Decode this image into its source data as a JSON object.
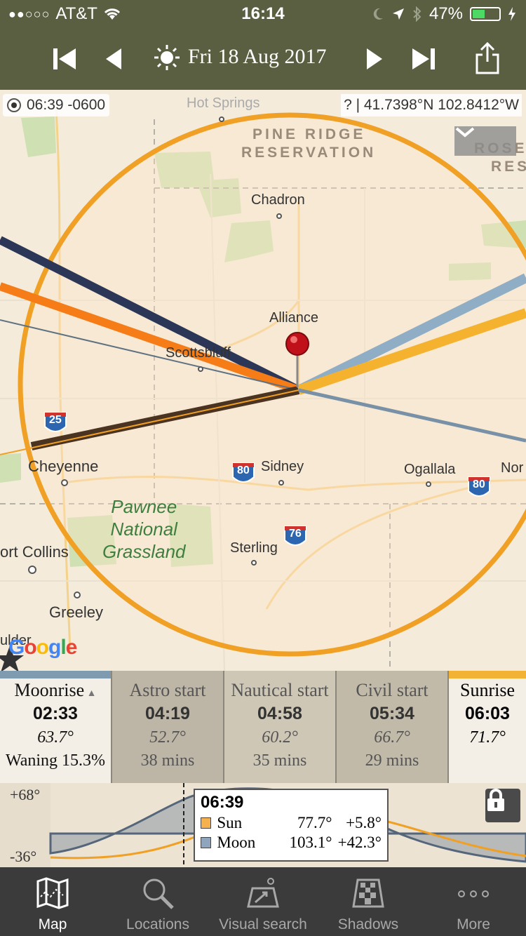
{
  "status_bar": {
    "carrier": "AT&T",
    "signal_dots": "●●○○○",
    "time": "16:14",
    "battery_percent": "47%",
    "battery_level": 0.47
  },
  "date_nav": {
    "date": "Fri 18 Aug 2017"
  },
  "map": {
    "time_zone_readout": "06:39 -0600",
    "coordinates": "? | 41.7398°N 102.8412°W",
    "labels": {
      "hot_springs": "Hot Springs",
      "pine_ridge_1": "PINE RIDGE",
      "pine_ridge_2": "RESERVATION",
      "rose_1": "ROSE",
      "rose_2": "RES",
      "chadron": "Chadron",
      "alliance": "Alliance",
      "scottsbluff": "Scottsbluff",
      "cheyenne": "Cheyenne",
      "sidney": "Sidney",
      "ogallala": "Ogallala",
      "nor": "Nor",
      "pawnee": "Pawnee\nNational\nGrassland",
      "sterling": "Sterling",
      "fort_collins": "ort Collins",
      "greeley": "Greeley",
      "boulder": "ulder",
      "hwy_25": "25",
      "hwy_80a": "80",
      "hwy_80b": "80",
      "hwy_76": "76"
    },
    "google_logo": "Google"
  },
  "events": [
    {
      "name": "Moonrise",
      "time": "02:33",
      "alt": "63.7°",
      "sub": "Waning 15.3%",
      "bar_color": "#7f9bb0",
      "bg": "#f3efe6",
      "arrow": true
    },
    {
      "name": "Astro start",
      "time": "04:19",
      "alt": "52.7°",
      "sub": "38 mins",
      "bar_color": "#bdb5a6",
      "bg": "#bdb5a6",
      "arrow": false
    },
    {
      "name": "Nautical start",
      "time": "04:58",
      "alt": "60.2°",
      "sub": "35 mins",
      "bar_color": "#cfc7b6",
      "bg": "#cfc7b6",
      "arrow": false
    },
    {
      "name": "Civil start",
      "time": "05:34",
      "alt": "66.7°",
      "sub": "29 mins",
      "bar_color": "#c2baa9",
      "bg": "#c2baa9",
      "arrow": false
    },
    {
      "name": "Sunrise",
      "time": "06:03",
      "alt": "71.7°",
      "sub": "",
      "bar_color": "#f2b233",
      "bg": "#f3efe6",
      "arrow": false
    }
  ],
  "graph": {
    "y_max_label": "+68°",
    "y_min_label": "-36°",
    "readout": {
      "time": "06:39",
      "rows": [
        {
          "name": "Sun",
          "azimuth": "77.7°",
          "elevation": "+5.8°",
          "color": "#f4b14e"
        },
        {
          "name": "Moon",
          "azimuth": "103.1°",
          "elevation": "+42.3°",
          "color": "#8fa4bd"
        }
      ]
    }
  },
  "tabs": [
    {
      "label": "Map",
      "icon": "map-icon",
      "active": true
    },
    {
      "label": "Locations",
      "icon": "magnifier-icon",
      "active": false
    },
    {
      "label": "Visual search",
      "icon": "visual-search-icon",
      "active": false
    },
    {
      "label": "Shadows",
      "icon": "shadows-icon",
      "active": false
    },
    {
      "label": "More",
      "icon": "more-dots-icon",
      "active": false
    }
  ],
  "colors": {
    "toolbar": "#595f40",
    "sun_circle": "#f0a024",
    "moon_line": "#2c3657",
    "sunrise_line": "#f4b22f",
    "moonrise_line": "#8fadc4"
  }
}
